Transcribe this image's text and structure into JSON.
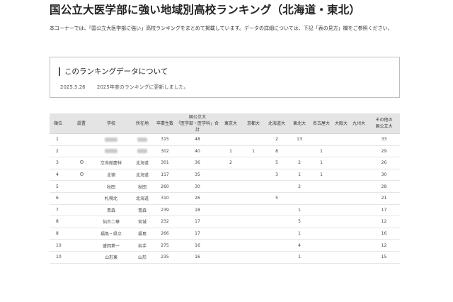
{
  "page": {
    "title": "国公立大医学部に強い地域別高校ランキング（北海道・東北）",
    "intro": "本コーナーでは、「国公立大医学部に強い」高校ランキングをまとめて掲載しています。データの詳細については、下記「表の見方」欄をご参照ください。"
  },
  "info": {
    "heading": "このランキングデータについて",
    "date": "2025.5.26",
    "text": "2025年度のランキングに更新しました。"
  },
  "table": {
    "headers": {
      "rank": "順位",
      "type": "設置",
      "school": "学校",
      "location": "所在地",
      "graduates": "卒業生数",
      "total_line1": "国公立大",
      "total_line2": "「医学部・医学科」合計",
      "tokyo": "東京大",
      "kyoto": "京都大",
      "hokkaido": "北海道大",
      "tohoku": "東北大",
      "nagoya": "名古屋大",
      "osaka": "大阪大",
      "kyushu": "九州大",
      "other_line1": "その他の",
      "other_line2": "国公立大"
    },
    "rows": [
      {
        "rank": "1",
        "type": "",
        "school": "",
        "location": "",
        "graduates": "315",
        "total": "48",
        "tokyo": "",
        "kyoto": "",
        "hokkaido": "2",
        "tohoku": "13",
        "nagoya": "",
        "osaka": "",
        "kyushu": "",
        "other": "33",
        "blurred": true
      },
      {
        "rank": "2",
        "type": "",
        "school": "",
        "location": "",
        "graduates": "302",
        "total": "40",
        "tokyo": "1",
        "kyoto": "1",
        "hokkaido": "8",
        "tohoku": "",
        "nagoya": "1",
        "osaka": "",
        "kyushu": "",
        "other": "29",
        "blurred": true
      },
      {
        "rank": "3",
        "type": "○",
        "school": "立命館慶祥",
        "location": "北海道",
        "graduates": "301",
        "total": "36",
        "tokyo": "2",
        "kyoto": "",
        "hokkaido": "5",
        "tohoku": "2",
        "nagoya": "1",
        "osaka": "",
        "kyushu": "",
        "other": "26",
        "blurred": false
      },
      {
        "rank": "4",
        "type": "○",
        "school": "北嶺",
        "location": "北海道",
        "graduates": "117",
        "total": "35",
        "tokyo": "",
        "kyoto": "",
        "hokkaido": "3",
        "tohoku": "1",
        "nagoya": "1",
        "osaka": "",
        "kyushu": "",
        "other": "30",
        "blurred": false
      },
      {
        "rank": "5",
        "type": "",
        "school": "秋田",
        "location": "秋田",
        "graduates": "260",
        "total": "30",
        "tokyo": "",
        "kyoto": "",
        "hokkaido": "",
        "tohoku": "2",
        "nagoya": "",
        "osaka": "",
        "kyushu": "",
        "other": "28",
        "blurred": false
      },
      {
        "rank": "6",
        "type": "",
        "school": "札幌北",
        "location": "北海道",
        "graduates": "310",
        "total": "26",
        "tokyo": "",
        "kyoto": "",
        "hokkaido": "5",
        "tohoku": "",
        "nagoya": "",
        "osaka": "",
        "kyushu": "",
        "other": "21",
        "blurred": false
      },
      {
        "rank": "7",
        "type": "",
        "school": "青森",
        "location": "青森",
        "graduates": "239",
        "total": "18",
        "tokyo": "",
        "kyoto": "",
        "hokkaido": "",
        "tohoku": "1",
        "nagoya": "",
        "osaka": "",
        "kyushu": "",
        "other": "17",
        "blurred": false
      },
      {
        "rank": "8",
        "type": "",
        "school": "仙台二華",
        "location": "宮城",
        "graduates": "232",
        "total": "17",
        "tokyo": "",
        "kyoto": "",
        "hokkaido": "",
        "tohoku": "5",
        "nagoya": "",
        "osaka": "",
        "kyushu": "",
        "other": "12",
        "blurred": false
      },
      {
        "rank": "8",
        "type": "",
        "school": "福島・県立",
        "location": "福島",
        "graduates": "266",
        "total": "17",
        "tokyo": "",
        "kyoto": "",
        "hokkaido": "",
        "tohoku": "1",
        "nagoya": "",
        "osaka": "",
        "kyushu": "",
        "other": "16",
        "blurred": false
      },
      {
        "rank": "10",
        "type": "",
        "school": "盛岡第一",
        "location": "岩手",
        "graduates": "275",
        "total": "16",
        "tokyo": "",
        "kyoto": "",
        "hokkaido": "",
        "tohoku": "4",
        "nagoya": "",
        "osaka": "",
        "kyushu": "",
        "other": "12",
        "blurred": false
      },
      {
        "rank": "10",
        "type": "",
        "school": "山形東",
        "location": "山形",
        "graduates": "235",
        "total": "16",
        "tokyo": "",
        "kyoto": "",
        "hokkaido": "",
        "tohoku": "1",
        "nagoya": "",
        "osaka": "",
        "kyushu": "",
        "other": "15",
        "blurred": false
      }
    ]
  }
}
